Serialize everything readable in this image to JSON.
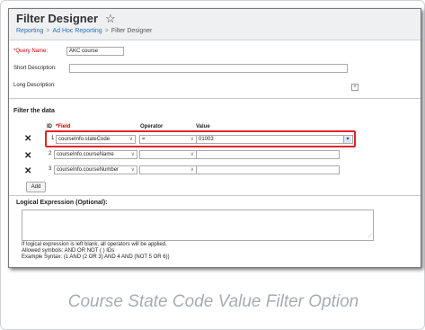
{
  "page": {
    "title": "Filter Designer",
    "star_icon": "star-outline-icon",
    "breadcrumb": [
      "Reporting",
      "Ad Hoc Reporting",
      "Filter Designer"
    ],
    "breadcrumb_sep": ">"
  },
  "form": {
    "query_name_label": "*Query Name:",
    "query_name_value": "AKC course",
    "short_description_label": "Short Description:",
    "short_description_value": "",
    "long_description_label": "Long Description:",
    "long_description_toggle": "+"
  },
  "filter": {
    "heading": "Filter the data",
    "columns": {
      "id": "ID",
      "field": "*Field",
      "operator": "Operator",
      "value": "Value"
    },
    "remove_icon": "close-x-icon",
    "rows": [
      {
        "id": "1",
        "field": "courseInfo.stateCode",
        "operator": "=",
        "value": "01003"
      },
      {
        "id": "2",
        "field": "courseInfo.courseName",
        "operator": "",
        "value": ""
      },
      {
        "id": "3",
        "field": "courseInfo.courseNumber",
        "operator": "",
        "value": ""
      }
    ],
    "add_label": "Add",
    "highlight_color": "#e0242b"
  },
  "logic": {
    "label": "Logical Expression (Optional):",
    "value": "",
    "notes": [
      "If logical expression is left blank, all operators will be applied.",
      "Allowed symbols: AND OR NOT ( ) IDs",
      "Example Syntax: (1 AND (2 OR 3) AND 4 AND (NOT 5 OR 6))"
    ]
  },
  "caption": "Course State Code Value Filter Option"
}
